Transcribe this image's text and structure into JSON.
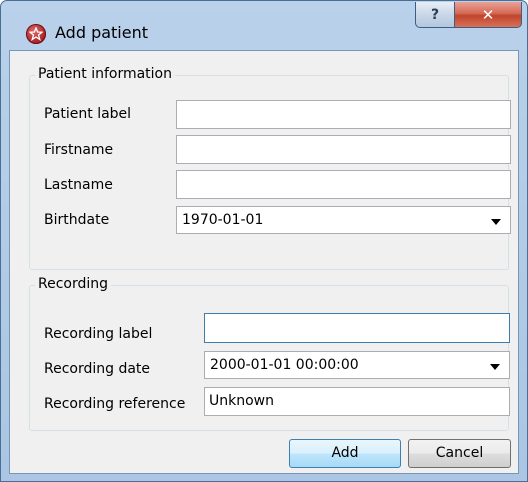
{
  "window": {
    "title": "Add patient",
    "help_glyph": "?",
    "close_glyph": "✕"
  },
  "patient_group": {
    "title": "Patient information",
    "patient_label": {
      "label": "Patient label",
      "value": ""
    },
    "firstname": {
      "label": "Firstname",
      "value": ""
    },
    "lastname": {
      "label": "Lastname",
      "value": ""
    },
    "birthdate": {
      "label": "Birthdate",
      "value": "1970-01-01"
    }
  },
  "recording_group": {
    "title": "Recording",
    "recording_label": {
      "label": "Recording label",
      "value": ""
    },
    "recording_date": {
      "label": "Recording date",
      "value": "2000-01-01 00:00:00"
    },
    "recording_reference": {
      "label": "Recording reference",
      "value": "Unknown"
    }
  },
  "buttons": {
    "add": "Add",
    "cancel": "Cancel"
  },
  "icons": {
    "app": "app-logo-icon",
    "help": "help-icon",
    "close": "close-icon",
    "dropdown": "chevron-down-icon"
  },
  "colors": {
    "title_bar": "#b9d1ea",
    "dialog_bg": "#f0f0f0",
    "focus_border": "#3d7bad",
    "close_button": "#c2442c"
  }
}
